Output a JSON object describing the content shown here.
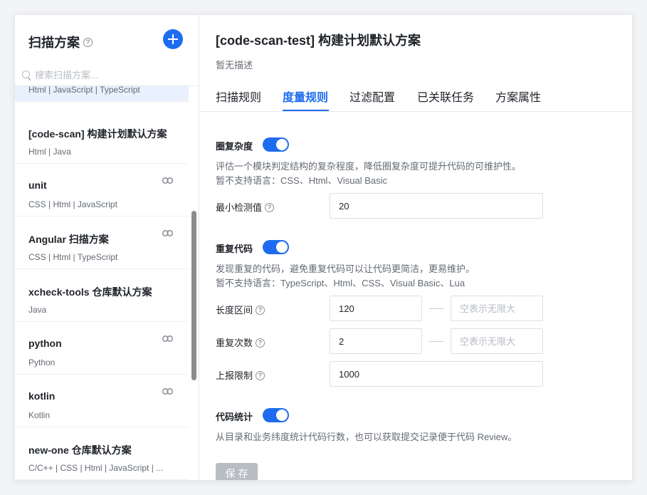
{
  "sidebar": {
    "title": "扫描方案",
    "search_placeholder": "搜索扫描方案...",
    "items": [
      {
        "name": "",
        "langs": "Html | JavaScript | TypeScript",
        "active": true,
        "linked": false
      },
      {
        "name": "[code-scan] 构建计划默认方案",
        "langs": "Html | Java",
        "linked": false
      },
      {
        "name": "unit",
        "langs": "CSS | Html | JavaScript",
        "linked": true
      },
      {
        "name": "Angular 扫描方案",
        "langs": "CSS | Html | TypeScript",
        "linked": true
      },
      {
        "name": "xcheck-tools 仓库默认方案",
        "langs": "Java",
        "linked": false
      },
      {
        "name": "python",
        "langs": "Python",
        "linked": true
      },
      {
        "name": "kotlin",
        "langs": "Kotlin",
        "linked": true
      },
      {
        "name": "new-one 仓库默认方案",
        "langs": "C/C++ | CSS | Html | JavaScript | ...",
        "linked": false
      }
    ]
  },
  "main": {
    "title": "[code-scan-test] 构建计划默认方案",
    "description": "暂无描述",
    "tabs": [
      "扫描规则",
      "度量规则",
      "过滤配置",
      "已关联任务",
      "方案属性"
    ],
    "active_tab": "度量规则"
  },
  "rules": {
    "complexity": {
      "title": "圈复杂度",
      "enabled": true,
      "desc_line1": "评估一个模块判定结构的复杂程度，降低圈复杂度可提升代码的可维护性。",
      "desc_line2": "暂不支持语言：CSS、Html、Visual Basic",
      "min_label": "最小检测值",
      "min_value": "20"
    },
    "duplicate": {
      "title": "重复代码",
      "enabled": true,
      "desc_line1": "发现重复的代码，避免重复代码可以让代码更简洁，更易维护。",
      "desc_line2": "暂不支持语言：TypeScript、Html、CSS、Visual Basic、Lua",
      "length_label": "长度区间",
      "length_min": "120",
      "length_max_placeholder": "空表示无限大",
      "count_label": "重复次数",
      "count_min": "2",
      "count_max_placeholder": "空表示无限大",
      "report_label": "上报限制",
      "report_value": "1000"
    },
    "stats": {
      "title": "代码统计",
      "enabled": true,
      "desc_line1": "从目录和业务纬度统计代码行数，也可以获取提交记录便于代码 Review。"
    }
  },
  "save_label": "保存",
  "colors": {
    "accent": "#1d6cf0",
    "disabled_button": "#b8bcc3"
  },
  "icons": [
    "help-icon",
    "add-icon",
    "search-icon",
    "link-icon"
  ]
}
